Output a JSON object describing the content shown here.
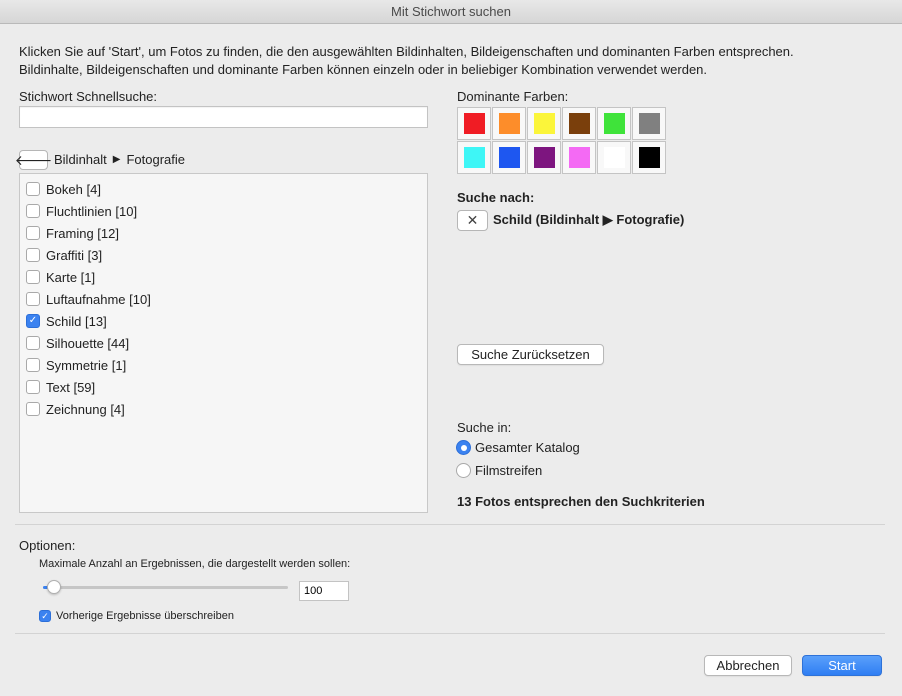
{
  "window": {
    "title": "Mit Stichwort suchen"
  },
  "intro": {
    "line1": "Klicken Sie auf 'Start', um Fotos zu finden, die den ausgewählten Bildinhalten, Bildeigenschaften und dominanten Farben entsprechen.",
    "line2": "Bildinhalte, Bildeigenschaften und dominante Farben können einzeln oder in beliebiger Kombination verwendet werden."
  },
  "quick_search": {
    "label": "Stichwort Schnellsuche:",
    "value": "",
    "placeholder": ""
  },
  "breadcrumb": {
    "back_icon": "arrow-left-icon",
    "parent": "Bildinhalt",
    "separator": "▶",
    "current": "Fotografie"
  },
  "keywords": [
    {
      "label": "Bokeh [4]",
      "checked": false
    },
    {
      "label": "Fluchtlinien [10]",
      "checked": false
    },
    {
      "label": "Framing [12]",
      "checked": false
    },
    {
      "label": "Graffiti [3]",
      "checked": false
    },
    {
      "label": "Karte [1]",
      "checked": false
    },
    {
      "label": "Luftaufnahme [10]",
      "checked": false
    },
    {
      "label": "Schild [13]",
      "checked": true
    },
    {
      "label": "Silhouette [44]",
      "checked": false
    },
    {
      "label": "Symmetrie [1]",
      "checked": false
    },
    {
      "label": "Text [59]",
      "checked": false
    },
    {
      "label": "Zeichnung [4]",
      "checked": false
    }
  ],
  "colors": {
    "label": "Dominante Farben:",
    "swatches": [
      "#f01c24",
      "#fd8d2a",
      "#fbf53a",
      "#7a3f0c",
      "#3fe33a",
      "#808080",
      "#3ef6f6",
      "#1e57f0",
      "#7d157f",
      "#f46af4",
      "#ffffff",
      "#000000"
    ]
  },
  "search_for": {
    "label": "Suche nach:",
    "chips": [
      {
        "icon": "close-icon",
        "label": "Schild (Bildinhalt ▶ Fotografie)"
      }
    ]
  },
  "reset_button": "Suche Zurücksetzen",
  "search_in": {
    "label": "Suche in:",
    "options": [
      {
        "label": "Gesamter Katalog",
        "selected": true
      },
      {
        "label": "Filmstreifen",
        "selected": false
      }
    ]
  },
  "results_text": "13 Fotos entsprechen den Suchkriterien",
  "options": {
    "label": "Optionen:",
    "max_results_label": "Maximale Anzahl an Ergebnissen, die dargestellt werden sollen:",
    "max_results_value": "100",
    "slider_fraction": 0.02,
    "overwrite_label": "Vorherige Ergebnisse überschreiben",
    "overwrite_checked": true
  },
  "buttons": {
    "cancel": "Abbrechen",
    "start": "Start"
  },
  "accent_color": "#3b82f0"
}
